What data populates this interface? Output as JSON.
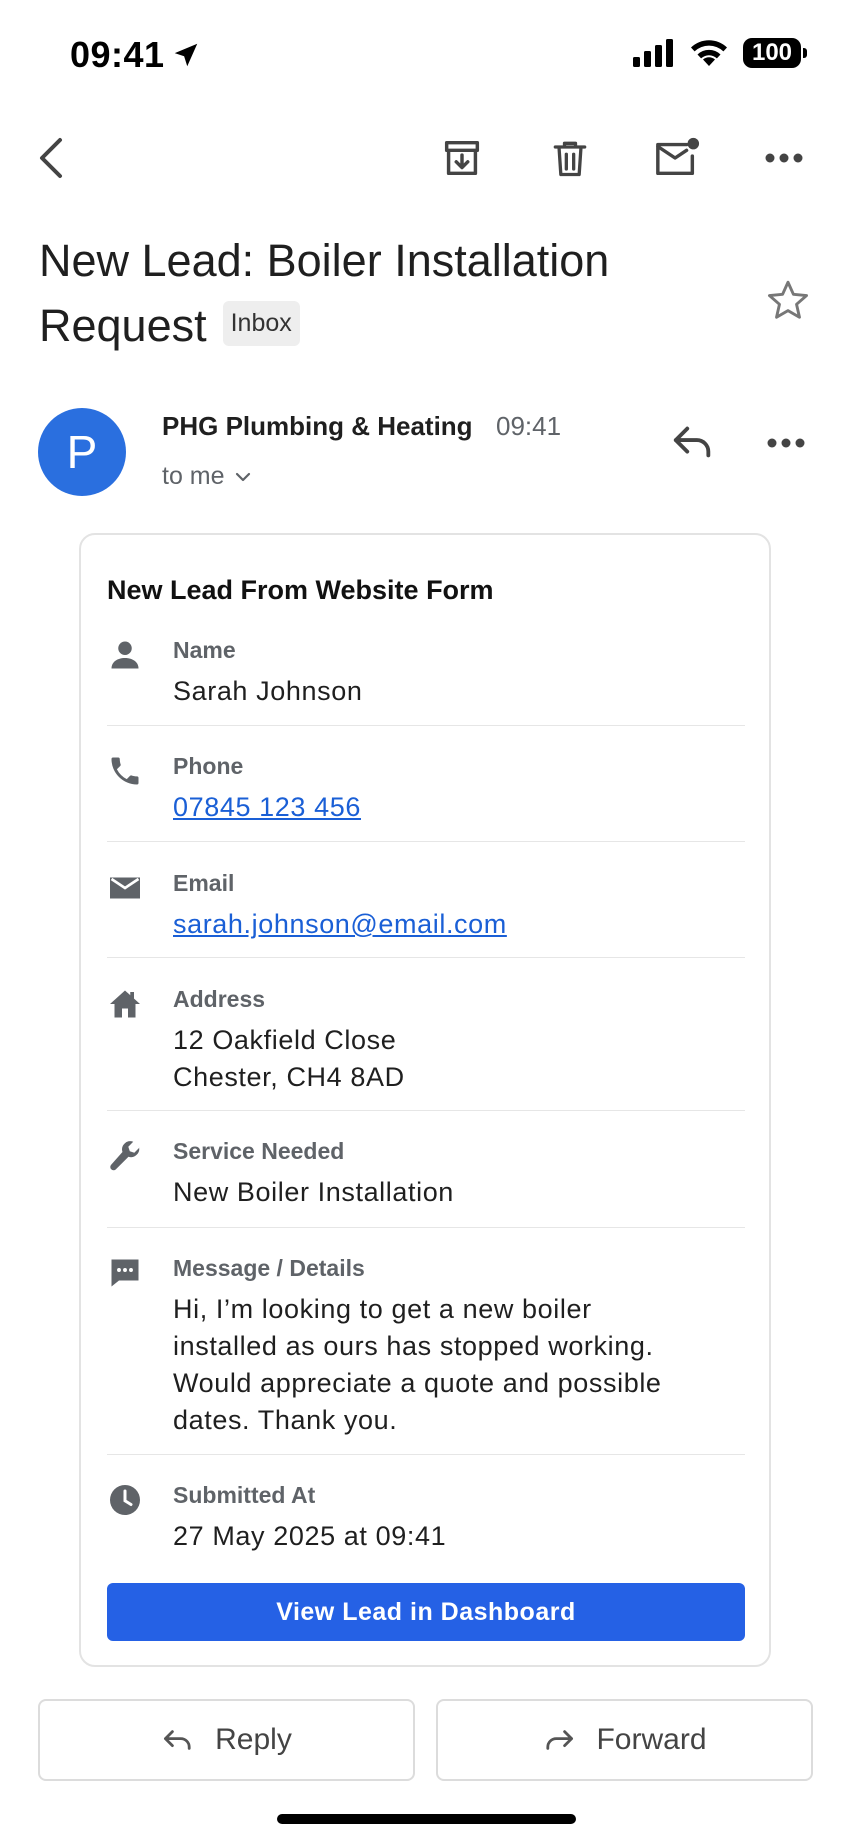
{
  "status_bar": {
    "time": "09:41",
    "battery": "100"
  },
  "toolbar": {
    "icons": [
      "back-icon",
      "archive-icon",
      "trash-icon",
      "mark-unread-icon",
      "more-icon"
    ]
  },
  "email": {
    "subject_line1": "New Lead: Boiler Installation",
    "subject_line2": "Request",
    "label_chip": "Inbox",
    "sender_initial": "P",
    "sender_name": "PHG Plumbing & Heating",
    "time": "09:41",
    "recipient": "to me"
  },
  "lead_card": {
    "title": "New Lead From Website Form",
    "fields": [
      {
        "label": "Name",
        "value": "Sarah Johnson",
        "icon": "person-icon"
      },
      {
        "label": "Phone",
        "value": "07845 123 456",
        "icon": "phone-icon"
      },
      {
        "label": "Email",
        "value": "sarah.johnson@email.com",
        "icon": "email-icon"
      },
      {
        "label": "Address",
        "value_line1": "12 Oakfield Close",
        "value_line2": "Chester, CH4 8AD",
        "icon": "home-icon"
      },
      {
        "label": "Service Needed",
        "value": "New Boiler Installation",
        "icon": "wrench-icon"
      },
      {
        "label": "Message / Details",
        "value_lines": [
          "Hi, I’m looking to get a new boiler",
          "installed as ours has stopped working.",
          "Would appreciate a quote and possible",
          "dates. Thank you."
        ],
        "icon": "message-icon"
      },
      {
        "label": "Submitted At",
        "value": "27 May 2025 at 09:41",
        "icon": "clock-icon"
      }
    ],
    "button_label": "View Lead in Dashboard"
  },
  "actions": {
    "reply_label": "Reply",
    "forward_label": "Forward"
  },
  "colors": {
    "accent": "#2561e5",
    "avatar": "#2a6fdf",
    "link": "#1a5fd6"
  }
}
